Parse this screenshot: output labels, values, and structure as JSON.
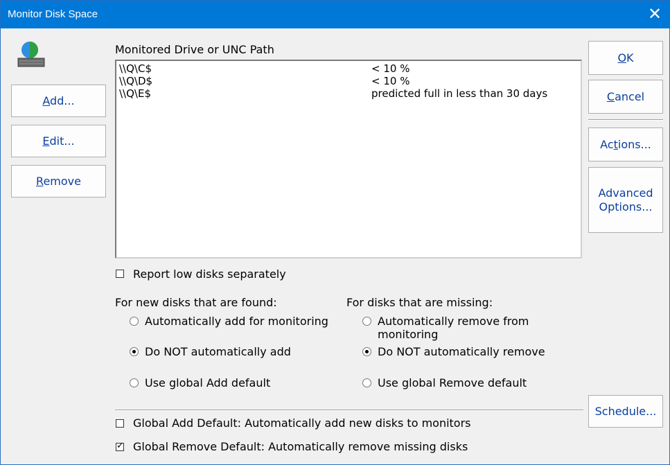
{
  "window": {
    "title": "Monitor Disk Space",
    "close_glyph": "✕"
  },
  "icon": {
    "name": "disk-space-icon"
  },
  "left_buttons": {
    "add": {
      "u": "A",
      "rest": "dd..."
    },
    "edit": {
      "u": "E",
      "rest": "dit..."
    },
    "remove": {
      "u": "R",
      "rest": "emove"
    }
  },
  "list": {
    "header": "Monitored Drive or UNC Path",
    "rows": [
      {
        "path": "\\\\Q\\C$",
        "condition": "< 10 %"
      },
      {
        "path": "\\\\Q\\D$",
        "condition": "< 10 %"
      },
      {
        "path": "\\\\Q\\E$",
        "condition": "predicted full in less than 30 days"
      }
    ]
  },
  "right_buttons": {
    "ok": {
      "u": "O",
      "rest": "K"
    },
    "cancel": {
      "u": "C",
      "rest": "ancel"
    },
    "actions": {
      "pre": "Ac",
      "u": "t",
      "rest": "ions..."
    },
    "advanced": {
      "line1": "Advanced",
      "line2": "Options..."
    },
    "schedule": {
      "label": "Schedule..."
    }
  },
  "report_low": {
    "label": "Report low disks separately",
    "checked": false
  },
  "new_disks": {
    "heading": "For new disks that are found:",
    "options": [
      {
        "label": "Automatically add for monitoring",
        "selected": false
      },
      {
        "label": "Do NOT automatically add",
        "selected": true
      },
      {
        "label": "Use global Add default",
        "selected": false
      }
    ]
  },
  "missing_disks": {
    "heading": "For disks that are missing:",
    "options": [
      {
        "line1": "Automatically remove from",
        "line2": "monitoring",
        "selected": false
      },
      {
        "label": "Do NOT automatically remove",
        "selected": true
      },
      {
        "label": "Use global Remove default",
        "selected": false
      }
    ]
  },
  "global_add": {
    "label": "Global Add Default: Automatically add new disks to monitors",
    "checked": false
  },
  "global_remove": {
    "label": "Global Remove Default: Automatically remove missing disks",
    "checked": true
  },
  "colors": {
    "titlebar": "#0078d7",
    "button_text": "#0b3f9f",
    "dialog_bg": "#f0f0f0"
  }
}
